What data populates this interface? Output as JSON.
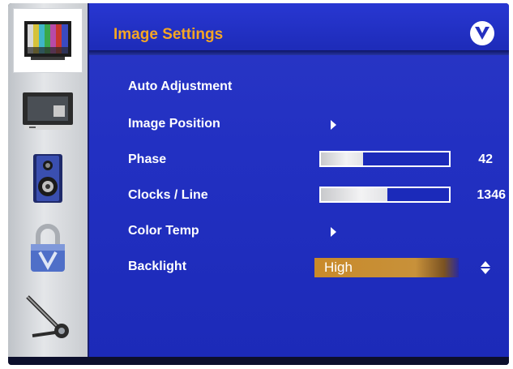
{
  "header": {
    "title": "Image Settings",
    "logo_icon": "vizio-v-logo"
  },
  "sidebar": {
    "items": [
      {
        "name": "picture",
        "icon": "tv-color-bars-icon",
        "selected": true
      },
      {
        "name": "input",
        "icon": "monitor-icon",
        "selected": false
      },
      {
        "name": "audio",
        "icon": "speaker-icon",
        "selected": false
      },
      {
        "name": "lock",
        "icon": "lock-icon",
        "selected": false
      },
      {
        "name": "setup",
        "icon": "wrench-icon",
        "selected": false
      }
    ]
  },
  "menu": {
    "rows": [
      {
        "label": "Auto Adjustment"
      },
      {
        "label": "Image Position",
        "type": "submenu"
      },
      {
        "label": "Phase",
        "type": "slider",
        "value": "42",
        "fill_percent": 33
      },
      {
        "label": "Clocks / Line",
        "type": "slider",
        "value": "1346",
        "fill_percent": 52
      },
      {
        "label": "Color Temp",
        "type": "submenu"
      },
      {
        "label": "Backlight",
        "type": "select",
        "value": "High"
      }
    ]
  },
  "colors": {
    "title": "#f5a623",
    "panel": "#2230c2",
    "highlight": "#c8913a"
  }
}
